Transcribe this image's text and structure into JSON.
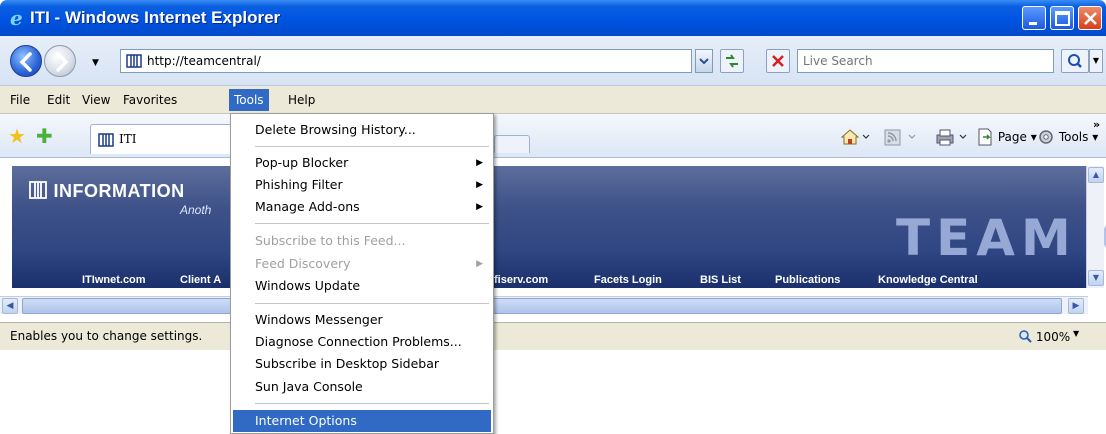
{
  "window": {
    "title": "ITI - Windows Internet Explorer",
    "minimize_label": "Minimize",
    "maximize_label": "Maximize",
    "close_label": "Close"
  },
  "address": {
    "url": "http://teamcentral/",
    "search_placeholder": "Live Search"
  },
  "menu": {
    "items": [
      "File",
      "Edit",
      "View",
      "Favorites",
      "Tools",
      "Help"
    ],
    "active": "Tools"
  },
  "tab": {
    "label": "ITI"
  },
  "command_bar": {
    "page_label": "Page",
    "tools_label": "Tools"
  },
  "banner": {
    "logo_text": "INFORMATION",
    "subline": "Anoth",
    "team_text": "TEAM C",
    "links": [
      "ITIwnet.com",
      "Client A",
      "fiserv.com",
      "Facets Login",
      "BIS List",
      "Publications",
      "Knowledge Central"
    ]
  },
  "status": {
    "text": "Enables you to change settings.",
    "zoom": "100%"
  },
  "tools_menu": {
    "items": [
      {
        "label": "Delete Browsing History...",
        "disabled": false,
        "submenu": false
      },
      {
        "label": "Pop-up Blocker",
        "disabled": false,
        "submenu": true
      },
      {
        "label": "Phishing Filter",
        "disabled": false,
        "submenu": true
      },
      {
        "label": "Manage Add-ons",
        "disabled": false,
        "submenu": true
      },
      {
        "label": "Subscribe to this Feed...",
        "disabled": true,
        "submenu": false
      },
      {
        "label": "Feed Discovery",
        "disabled": true,
        "submenu": true
      },
      {
        "label": "Windows Update",
        "disabled": false,
        "submenu": false
      },
      {
        "label": "Windows Messenger",
        "disabled": false,
        "submenu": false
      },
      {
        "label": "Diagnose Connection Problems...",
        "disabled": false,
        "submenu": false
      },
      {
        "label": "Subscribe in Desktop Sidebar",
        "disabled": false,
        "submenu": false
      },
      {
        "label": "Sun Java Console",
        "disabled": false,
        "submenu": false
      },
      {
        "label": "Internet Options",
        "disabled": false,
        "submenu": false,
        "selected": true
      }
    ]
  },
  "colors": {
    "titlebar": "#0054e3",
    "menu_highlight": "#316ac5",
    "banner": "#2f4683"
  }
}
